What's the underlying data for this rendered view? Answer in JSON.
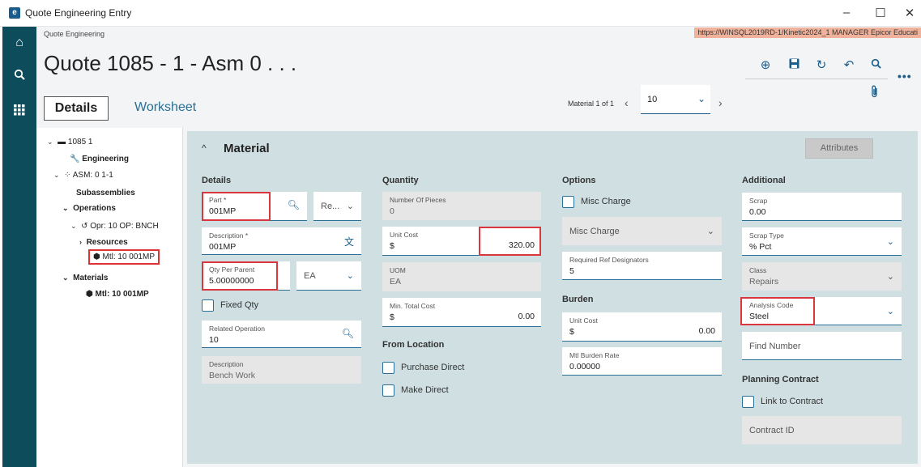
{
  "window": {
    "title": "Quote Engineering Entry",
    "logo_letter": "e"
  },
  "header": {
    "breadcrumb": "Quote Engineering",
    "url_info": "https://WINSQL2019RD-1/Kinetic2024_1   MANAGER   Epicor Educati",
    "page_title": "Quote 1085 - 1 - Asm 0 . . .",
    "tabs": {
      "details": "Details",
      "worksheet": "Worksheet"
    },
    "pager": {
      "label": "Material 1 of 1",
      "value": "10"
    }
  },
  "tree": {
    "root": "1085 1",
    "engineering": "Engineering",
    "asm": "ASM: 0 1-1",
    "subassemblies": "Subassemblies",
    "operations": "Operations",
    "opr": "Opr: 10 OP: BNCH",
    "resources": "Resources",
    "mtl_selected": "Mtl: 10 001MP",
    "materials": "Materials",
    "mtl": "Mtl: 10 001MP"
  },
  "panel": {
    "title": "Material",
    "attributes_button": "Attributes"
  },
  "details": {
    "title": "Details",
    "part_label": "Part *",
    "part_value": "001MP",
    "rev_value": "Re...",
    "description_label": "Description *",
    "description_value": "001MP",
    "qty_label": "Qty Per Parent",
    "qty_value": "5.00000000",
    "uom_value": "EA",
    "fixed_qty": "Fixed Qty",
    "related_op_label": "Related Operation",
    "related_op_value": "10",
    "op_desc_label": "Description",
    "op_desc_value": "Bench Work"
  },
  "quantity": {
    "title": "Quantity",
    "pieces_label": "Number Of Pieces",
    "pieces_value": "0",
    "unit_cost_label": "Unit Cost",
    "currency": "$",
    "unit_cost_value": "320.00",
    "uom_label": "UOM",
    "uom_value": "EA",
    "min_total_label": "Min. Total Cost",
    "min_total_value": "0.00",
    "from_location": "From Location",
    "purchase_direct": "Purchase Direct",
    "make_direct": "Make Direct"
  },
  "options": {
    "title": "Options",
    "misc_charge_cb": "Misc Charge",
    "misc_charge_select": "Misc Charge",
    "ref_designators_label": "Required Ref Designators",
    "ref_designators_value": "5",
    "burden_title": "Burden",
    "burden_unit_cost_label": "Unit Cost",
    "burden_unit_cost_value": "0.00",
    "burden_rate_label": "Mtl Burden Rate",
    "burden_rate_value": "0.00000"
  },
  "additional": {
    "title": "Additional",
    "scrap_label": "Scrap",
    "scrap_value": "0.00",
    "scrap_type_label": "Scrap Type",
    "scrap_type_value": "% Pct",
    "class_label": "Class",
    "class_value": "Repairs",
    "analysis_label": "Analysis Code",
    "analysis_value": "Steel",
    "find_number": "Find Number",
    "planning_title": "Planning Contract",
    "link_contract": "Link to Contract",
    "contract_id": "Contract ID"
  },
  "colors": {
    "rail": "#0d4d5b",
    "accent": "#2a6f96",
    "highlight": "#d9363e",
    "panel": "#cfdfe2"
  }
}
